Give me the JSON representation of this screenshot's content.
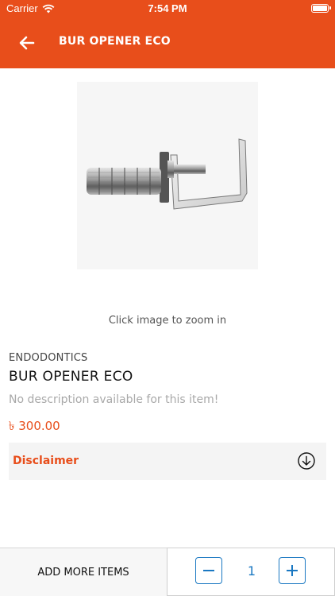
{
  "status_bar": {
    "carrier": "Carrier",
    "time": "7:54 PM",
    "wifi_icon": "wifi-icon",
    "battery_icon": "battery-icon"
  },
  "header": {
    "title": "BUR OPENER ECO",
    "back_icon": "arrow-left-icon",
    "background_color": "#e84e1b"
  },
  "product": {
    "image_alt": "bur-opener-product-photo",
    "zoom_hint": "Click image to zoom in",
    "category": "ENDODONTICS",
    "name": "BUR OPENER ECO",
    "description": "No description available for this item!",
    "price": "৳ 300.00",
    "disclaimer_label": "Disclaimer",
    "disclaimer_icon": "circle-arrow-down-icon"
  },
  "bottom_bar": {
    "add_more_label": "ADD MORE ITEMS",
    "quantity": "1",
    "minus_icon": "minus-icon",
    "plus_icon": "plus-icon",
    "accent_color": "#1a78c2"
  }
}
